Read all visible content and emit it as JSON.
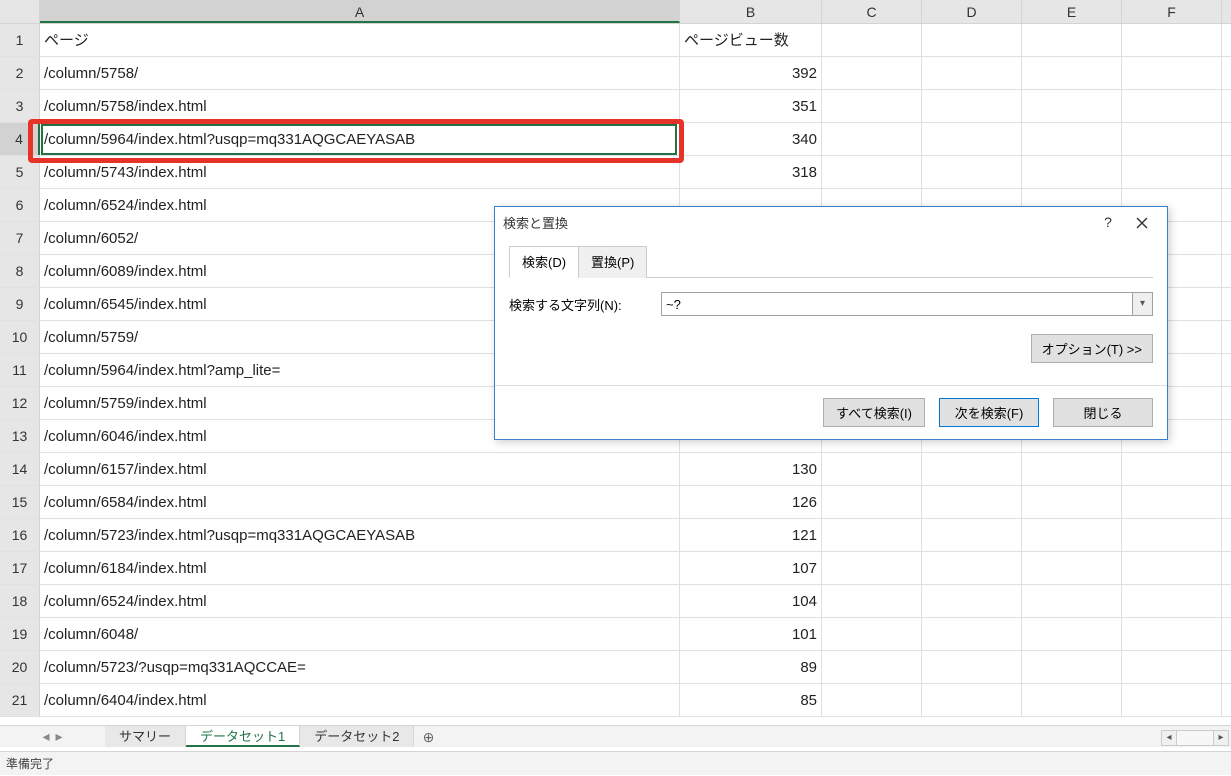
{
  "columns": [
    "A",
    "B",
    "C",
    "D",
    "E",
    "F"
  ],
  "active_col": "A",
  "active_row": 4,
  "headers": {
    "A": "ページ",
    "B": "ページビュー数"
  },
  "rows": [
    {
      "n": 1,
      "A": "__HEADER__"
    },
    {
      "n": 2,
      "A": "/column/5758/",
      "B": "392"
    },
    {
      "n": 3,
      "A": "/column/5758/index.html",
      "B": "351"
    },
    {
      "n": 4,
      "A": "/column/5964/index.html?usqp=mq331AQGCAEYASAB",
      "B": "340"
    },
    {
      "n": 5,
      "A": "/column/5743/index.html",
      "B": "318"
    },
    {
      "n": 6,
      "A": "/column/6524/index.html",
      "B": ""
    },
    {
      "n": 7,
      "A": "/column/6052/",
      "B": ""
    },
    {
      "n": 8,
      "A": "/column/6089/index.html",
      "B": ""
    },
    {
      "n": 9,
      "A": "/column/6545/index.html",
      "B": ""
    },
    {
      "n": 10,
      "A": "/column/5759/",
      "B": ""
    },
    {
      "n": 11,
      "A": "/column/5964/index.html?amp_lite=",
      "B": ""
    },
    {
      "n": 12,
      "A": "/column/5759/index.html",
      "B": ""
    },
    {
      "n": 13,
      "A": "/column/6046/index.html",
      "B": ""
    },
    {
      "n": 14,
      "A": "/column/6157/index.html",
      "B": "130"
    },
    {
      "n": 15,
      "A": "/column/6584/index.html",
      "B": "126"
    },
    {
      "n": 16,
      "A": "/column/5723/index.html?usqp=mq331AQGCAEYASAB",
      "B": "121"
    },
    {
      "n": 17,
      "A": "/column/6184/index.html",
      "B": "107"
    },
    {
      "n": 18,
      "A": "/column/6524/index.html",
      "B": "104"
    },
    {
      "n": 19,
      "A": "/column/6048/",
      "B": "101"
    },
    {
      "n": 20,
      "A": "/column/5723/?usqp=mq331AQCCAE=",
      "B": "89"
    },
    {
      "n": 21,
      "A": "/column/6404/index.html",
      "B": "85"
    }
  ],
  "sheets": {
    "items": [
      "サマリー",
      "データセット1",
      "データセット2"
    ],
    "active": 1
  },
  "status": "準備完了",
  "dialog": {
    "title": "検索と置換",
    "tabs": {
      "search": "検索(D)",
      "replace": "置換(P)"
    },
    "search_label": "検索する文字列(N):",
    "search_value": "~?",
    "options_btn": "オプション(T) >>",
    "btn_find_all": "すべて検索(I)",
    "btn_find_next": "次を検索(F)",
    "btn_close": "閉じる"
  }
}
